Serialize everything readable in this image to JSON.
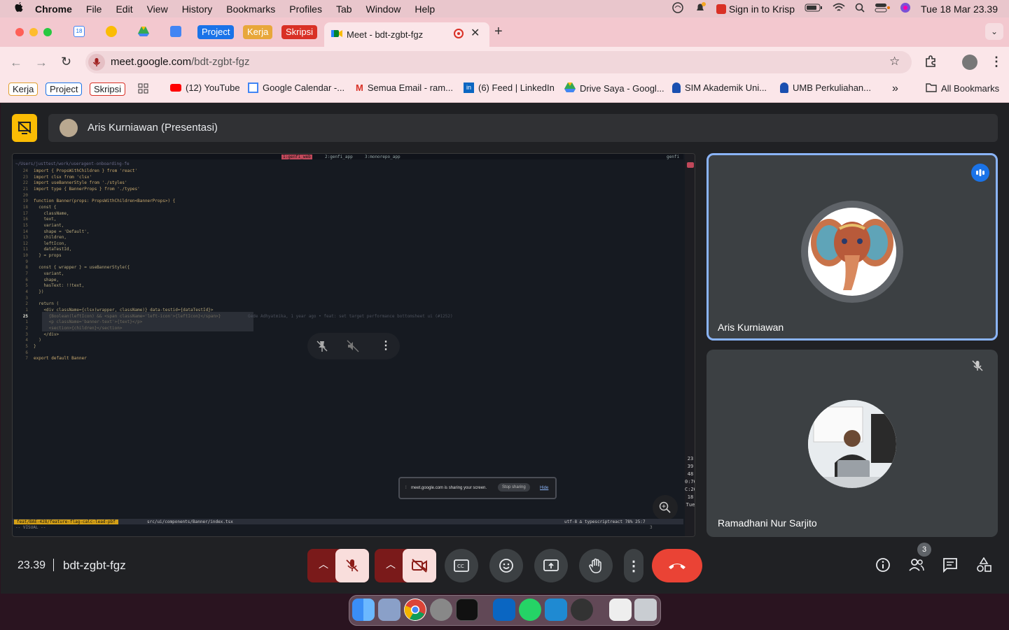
{
  "menubar": {
    "app": "Chrome",
    "items": [
      "File",
      "Edit",
      "View",
      "History",
      "Bookmarks",
      "Profiles",
      "Tab",
      "Window",
      "Help"
    ],
    "krisp": "Sign in to Krisp",
    "clock": "Tue 18 Mar  23.39"
  },
  "tabs": {
    "groups": [
      "Project",
      "Kerja",
      "Skripsi"
    ],
    "active_title": "Meet - bdt-zgbt-fgz",
    "calendar_day": "18"
  },
  "url": {
    "domain": "meet.google.com",
    "path": "/bdt-zgbt-fgz"
  },
  "bookmarks": {
    "chips": [
      "Kerja",
      "Project",
      "Skripsi"
    ],
    "items": [
      "(12) YouTube",
      "Google Calendar -...",
      "Semua Email - ram...",
      "(6) Feed | LinkedIn",
      "Drive Saya - Googl...",
      "SIM Akademik Uni...",
      "UMB Perkuliahan..."
    ],
    "all": "All Bookmarks"
  },
  "meet": {
    "presenter": "Aris Kurniawan (Presentasi)",
    "participants": [
      {
        "name": "Aris Kurniawan"
      },
      {
        "name": "Ramadhani Nur Sarjito"
      }
    ],
    "time": "23.39",
    "code": "bdt-zgbt-fgz",
    "people_count": "3",
    "share_banner": {
      "text": "meet.google.com is sharing your screen.",
      "stop": "Stop sharing",
      "hide": "Hide"
    }
  },
  "terminal": {
    "path": "~/Users/justtest/work/useragent-onboarding-fe",
    "tmux_tabs": [
      "1:genfi_web",
      "2:genfi_app",
      "3:monorepo_app"
    ],
    "tmux_right": "genfi",
    "lines": [
      {
        "n": "24",
        "t": "import { PropsWithChildren } from 'react'"
      },
      {
        "n": "23",
        "t": "import clsx from 'clsx'"
      },
      {
        "n": "22",
        "t": "import useBannerStyle from './styles'"
      },
      {
        "n": "21",
        "t": "import type { BannerProps } from './types'"
      },
      {
        "n": "20",
        "t": ""
      },
      {
        "n": "19",
        "t": "function Banner(props: PropsWithChildren<BannerProps>) {"
      },
      {
        "n": "18",
        "t": "  const {"
      },
      {
        "n": "17",
        "t": "    className,"
      },
      {
        "n": "16",
        "t": "    text,"
      },
      {
        "n": "15",
        "t": "    variant,"
      },
      {
        "n": "14",
        "t": "    shape = 'Default',"
      },
      {
        "n": "13",
        "t": "    children,"
      },
      {
        "n": "12",
        "t": "    leftIcon,"
      },
      {
        "n": "11",
        "t": "    dataTestId,"
      },
      {
        "n": "10",
        "t": "  } = props"
      },
      {
        "n": "9",
        "t": ""
      },
      {
        "n": "8",
        "t": "  const { wrapper } = useBannerStyle({"
      },
      {
        "n": "7",
        "t": "    variant,"
      },
      {
        "n": "6",
        "t": "    shape,"
      },
      {
        "n": "5",
        "t": "    hasText: !!text,"
      },
      {
        "n": "4",
        "t": "  })"
      },
      {
        "n": "3",
        "t": ""
      },
      {
        "n": "2",
        "t": "  return ("
      },
      {
        "n": "1",
        "t": "    <div className={clsx(wrapper, className)} data-testid={dataTestId}>"
      },
      {
        "n": "25",
        "t": "      {Boolean(leftIcon) && <span className='left-icon'>{leftIcon}</span>}"
      },
      {
        "n": "1",
        "t": "      <p className='banner-text'>{text}</p>"
      },
      {
        "n": "2",
        "t": "      <section>{children}</section>"
      },
      {
        "n": "3",
        "t": "    </div>"
      },
      {
        "n": "4",
        "t": "  )"
      },
      {
        "n": "5",
        "t": "}"
      },
      {
        "n": "6",
        "t": ""
      },
      {
        "n": "7",
        "t": "export default Banner"
      }
    ],
    "blame": "Gede Adhyatmika, 1 year ago • feat: set target performance bottomsheet ui (#1252)",
    "status_branch": "feat/BAE-428/feature-flag-calc-lead-pbf",
    "status_file": "src/ui/components/Banner/index.tsx",
    "status_right": "utf-8  ∆  typescriptreact  78%  25:7",
    "mode": "-- VISUAL --",
    "mode_count": "3",
    "side_numbers": [
      "23",
      "39",
      "48",
      "0:76",
      "C:26",
      "18",
      "Tue"
    ]
  },
  "colors": {
    "accent": "#8ab4f8",
    "end_call": "#ea4335",
    "mute_bg": "#f9dedc",
    "present": "#fbbc04"
  }
}
